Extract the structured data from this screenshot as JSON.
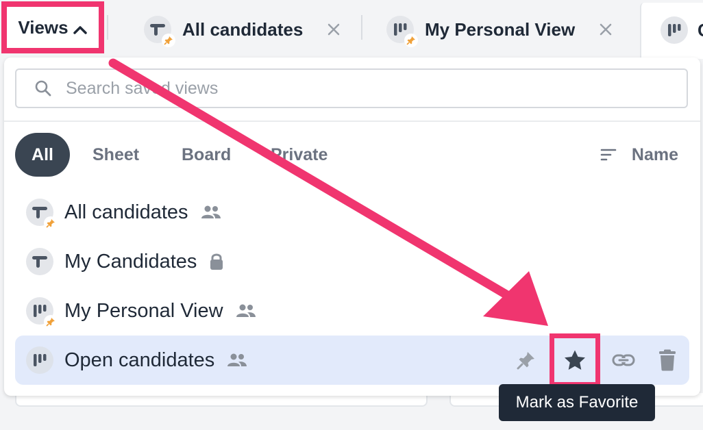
{
  "header": {
    "views_label": "Views",
    "tabs": [
      {
        "label": "All candidates",
        "icon": "sheet-icon",
        "pinned": true
      },
      {
        "label": "My Personal View",
        "icon": "board-icon",
        "pinned": true
      },
      {
        "label": "C",
        "icon": "board-icon",
        "pinned": false
      }
    ]
  },
  "dropdown": {
    "search": {
      "placeholder": "Search saved views",
      "value": ""
    },
    "filters": [
      "All",
      "Sheet",
      "Board",
      "Private"
    ],
    "active_filter": "All",
    "sort_label": "Name",
    "views": [
      {
        "name": "All candidates",
        "icon": "sheet-icon",
        "pinned": true,
        "access": "shared-icon"
      },
      {
        "name": "My Candidates",
        "icon": "sheet-icon",
        "pinned": false,
        "access": "lock-icon"
      },
      {
        "name": "My Personal View",
        "icon": "board-icon",
        "pinned": true,
        "access": "shared-icon"
      },
      {
        "name": "Open candidates",
        "icon": "board-icon",
        "pinned": false,
        "access": "shared-icon",
        "hovered": true
      }
    ]
  },
  "tooltip": "Mark as Favorite",
  "colors": {
    "annotation": "#f0356f",
    "active_filter_bg": "#3a4552",
    "hover_row_bg": "#e2eafb",
    "pin": "#f0a13a",
    "tooltip_bg": "#1f2937"
  }
}
